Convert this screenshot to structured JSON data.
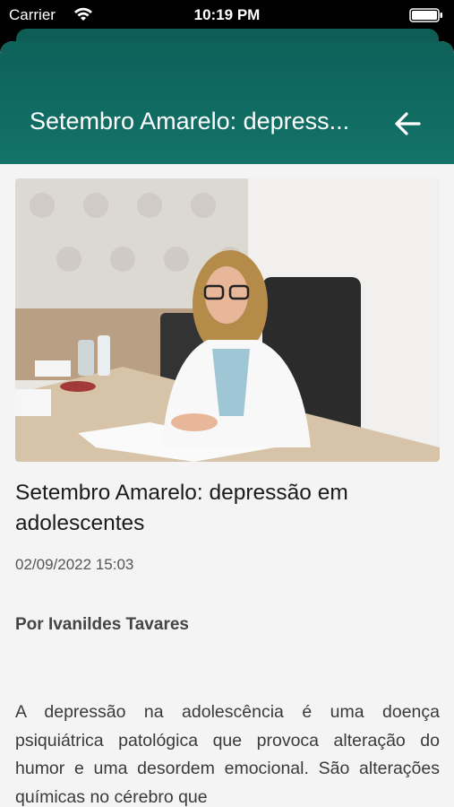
{
  "status_bar": {
    "carrier": "Carrier",
    "time": "10:19 PM"
  },
  "header": {
    "title": "Setembro Amarelo: depress...",
    "back_icon": "arrow-left-icon",
    "color": "#0f6b62"
  },
  "article": {
    "image_alt": "woman in white coat at desk",
    "title": "Setembro Amarelo: depressão em adolescentes",
    "date": "02/09/2022 15:03",
    "author": "Por Ivanildes Tavares",
    "body": "A depressão na adolescência é uma doença psiquiátrica patológica que provoca alteração do humor e uma desordem emocional. São alterações químicas no cérebro que"
  }
}
